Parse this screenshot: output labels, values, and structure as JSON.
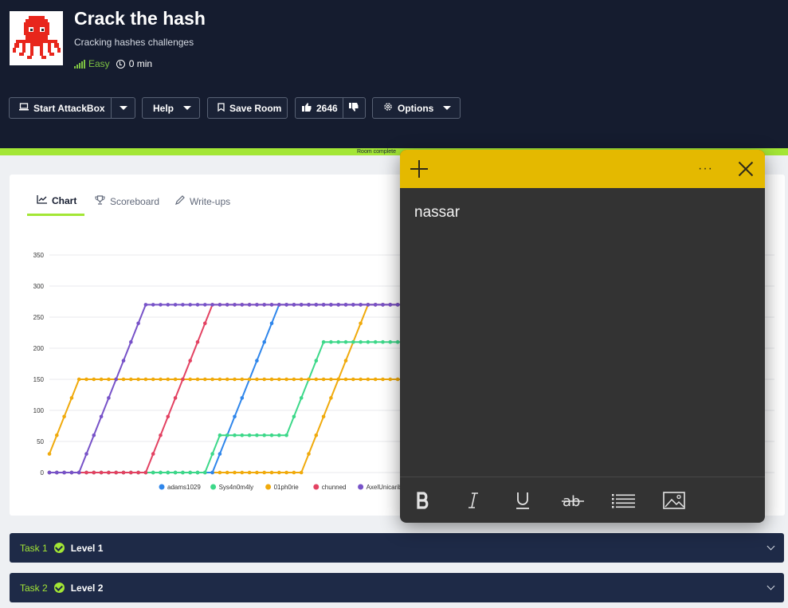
{
  "room": {
    "title": "Crack the hash",
    "subtitle": "Cracking hashes challenges",
    "difficulty": "Easy",
    "duration": "0 min",
    "progress_text": "Room complete"
  },
  "toolbar": {
    "attackbox_label": "Start AttackBox",
    "help_label": "Help",
    "save_label": "Save Room",
    "like_count": "2646",
    "options_label": "Options"
  },
  "tabs": [
    {
      "label": "Chart",
      "icon": "chart-icon",
      "active": true
    },
    {
      "label": "Scoreboard",
      "icon": "trophy-icon",
      "active": false
    },
    {
      "label": "Write-ups",
      "icon": "pen-icon",
      "active": false
    }
  ],
  "chart_data": {
    "type": "line",
    "ylim": [
      0,
      350
    ],
    "yticks": [
      0,
      50,
      100,
      150,
      200,
      250,
      300,
      350
    ],
    "grid": true,
    "legend_position": "bottom",
    "series": [
      {
        "name": "adams1029",
        "color": "#2f86eb",
        "values": [
          0,
          0,
          0,
          0,
          0,
          0,
          0,
          0,
          0,
          0,
          0,
          0,
          0,
          0,
          0,
          0,
          0,
          0,
          0,
          0,
          0,
          0,
          0,
          30,
          60,
          90,
          120,
          150,
          180,
          210,
          240,
          270,
          270,
          270,
          270,
          270,
          270,
          270,
          270,
          270,
          270,
          270,
          270,
          270,
          270,
          270,
          270,
          270,
          270,
          270,
          270,
          270,
          270,
          270,
          270,
          270,
          270,
          270,
          270,
          270,
          270,
          270,
          270,
          270,
          270,
          270,
          270,
          270,
          270,
          270
        ]
      },
      {
        "name": "Sys4n0m4ly",
        "color": "#3cd889",
        "values": [
          0,
          0,
          0,
          0,
          0,
          0,
          0,
          0,
          0,
          0,
          0,
          0,
          0,
          0,
          0,
          0,
          0,
          0,
          0,
          0,
          0,
          0,
          30,
          60,
          60,
          60,
          60,
          60,
          60,
          60,
          60,
          60,
          60,
          90,
          120,
          150,
          180,
          210,
          210,
          210,
          210,
          210,
          210,
          210,
          210,
          210,
          210,
          210,
          210,
          210,
          210,
          210,
          210,
          210,
          210,
          210,
          210,
          210,
          210,
          210,
          210,
          210,
          210,
          210,
          210,
          210,
          210,
          210,
          210,
          210
        ]
      },
      {
        "name": "01ph0rie",
        "color": "#f0aa0c",
        "values": [
          30,
          60,
          90,
          120,
          150,
          150,
          150,
          150,
          150,
          150,
          150,
          150,
          150,
          150,
          150,
          150,
          150,
          150,
          150,
          150,
          150,
          150,
          150,
          150,
          150,
          150,
          150,
          150,
          150,
          150,
          150,
          150,
          150,
          150,
          150,
          150,
          150,
          150,
          150,
          150,
          150,
          150,
          150,
          150,
          150,
          150,
          150,
          150,
          150,
          150,
          150,
          150,
          150,
          150,
          150,
          150,
          150,
          150,
          150,
          150,
          150,
          150,
          150,
          150,
          150,
          150,
          150,
          150,
          150,
          150
        ]
      },
      {
        "name": "chunned",
        "color": "#e34262",
        "values": [
          0,
          0,
          0,
          0,
          0,
          0,
          0,
          0,
          0,
          0,
          0,
          0,
          0,
          0,
          30,
          60,
          90,
          120,
          150,
          180,
          210,
          240,
          270,
          270,
          270,
          270,
          270,
          270,
          270,
          270,
          270,
          270,
          270,
          270,
          270,
          270,
          270,
          270,
          270,
          270,
          270,
          270,
          270,
          270,
          270,
          270,
          270,
          270,
          270,
          270,
          270,
          270,
          270,
          270,
          270,
          270,
          270,
          270,
          270,
          270,
          270,
          270,
          270,
          270,
          270,
          270,
          270,
          270,
          270,
          270
        ]
      },
      {
        "name": "AxelUnicaribe",
        "color": "#7752c8",
        "values": [
          0,
          0,
          0,
          0,
          0,
          30,
          60,
          90,
          120,
          150,
          180,
          210,
          240,
          270,
          270,
          270,
          270,
          270,
          270,
          270,
          270,
          270,
          270,
          270,
          270,
          270,
          270,
          270,
          270,
          270,
          270,
          270,
          270,
          270,
          270,
          270,
          270,
          270,
          270,
          270,
          270,
          270,
          270,
          270,
          270,
          270,
          270,
          270,
          270,
          270,
          270,
          270,
          270,
          270,
          270,
          270,
          270,
          270,
          270,
          270,
          270,
          270,
          270,
          270,
          270,
          270,
          270,
          270,
          270,
          270
        ]
      }
    ],
    "extra_series_visible": {
      "name": "",
      "color": "#f0aa0c",
      "values": [
        0,
        0,
        0,
        0,
        0,
        0,
        0,
        0,
        0,
        0,
        0,
        0,
        0,
        0,
        0,
        0,
        0,
        0,
        0,
        0,
        0,
        0,
        0,
        0,
        0,
        0,
        0,
        0,
        0,
        0,
        0,
        0,
        0,
        0,
        0,
        30,
        60,
        90,
        120,
        150,
        180,
        210,
        240,
        270,
        270,
        270,
        270,
        270,
        270,
        270,
        270,
        270,
        270,
        270,
        270,
        270,
        270,
        270,
        270,
        270,
        270,
        270,
        270,
        270,
        270,
        270,
        270,
        270,
        270,
        270
      ]
    }
  },
  "tasks": [
    {
      "label": "Task 1",
      "name": "Level 1"
    },
    {
      "label": "Task 2",
      "name": "Level 2"
    }
  ],
  "note": {
    "text": "nassar",
    "accent": "#e4b900"
  },
  "colors": {
    "header_bg": "#151c2f",
    "accent_green": "#a3e635",
    "task_bg": "#1e2a47"
  }
}
